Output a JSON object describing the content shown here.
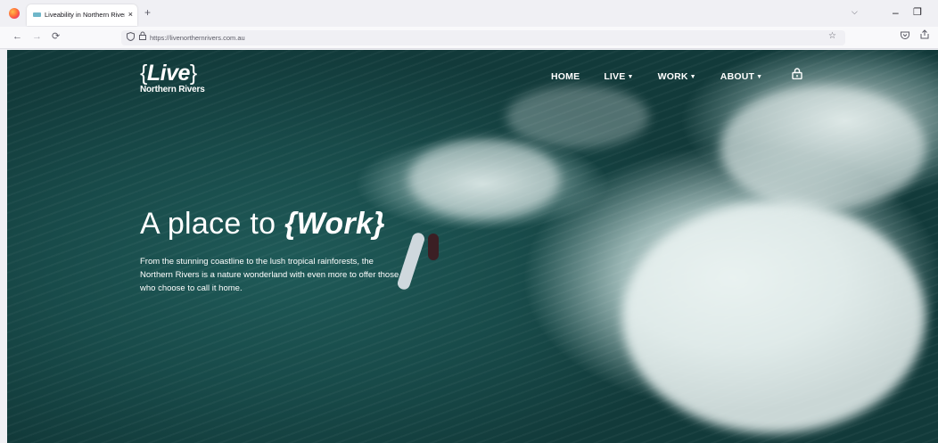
{
  "browser": {
    "tab_title": "Liveability in Northern Rivers N",
    "tab_close": "×",
    "new_tab": "+",
    "tabs_list": "⌵",
    "minimize": "–",
    "restore": "❐",
    "back": "←",
    "forward": "→",
    "reload": "⟳",
    "url": "https://livenorthernrivers.com.au"
  },
  "site": {
    "logo": {
      "brace_open": "{",
      "word": "Live",
      "brace_close": "}",
      "subtitle": "Northern Rivers"
    },
    "nav": [
      {
        "label": "HOME",
        "has_dropdown": false
      },
      {
        "label": "LIVE",
        "has_dropdown": true
      },
      {
        "label": "WORK",
        "has_dropdown": true
      },
      {
        "label": "ABOUT",
        "has_dropdown": true
      }
    ],
    "caret": "▼",
    "hero": {
      "title_prefix": "A place to ",
      "title_accent": "{Work}",
      "body": "From the stunning coastline to the lush tropical rainforests, the Northern Rivers is a nature wonderland with even more to offer those who choose to call it home."
    }
  },
  "icons": {
    "browser_logo": "firefox-logo-icon",
    "shield": "tracking-shield-icon",
    "lock": "padlock-icon",
    "bookmark": "star-icon",
    "pocket": "pocket-icon",
    "share": "share-icon",
    "site_lock": "padlock-icon"
  },
  "colors": {
    "water_dark": "#123a3a",
    "water_mid": "#1f5a58",
    "foam": "#e6f0ee",
    "text": "#ffffff",
    "chrome": "#f0f0f4"
  }
}
